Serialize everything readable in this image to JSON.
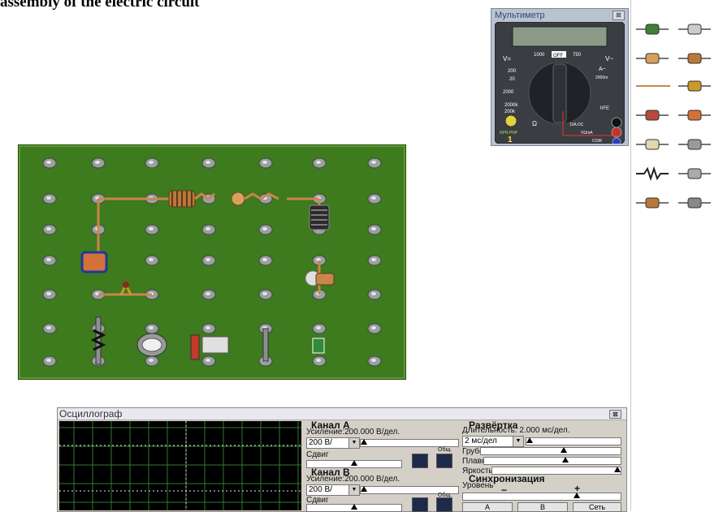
{
  "heading": "assembly of the electric circuit",
  "multimeter": {
    "title": "Мультиметр",
    "close_label": "⊠",
    "label_v_dc": "V=",
    "label_v_ac": "V~",
    "label_off": "OFF",
    "label_1000": "1000",
    "label_750": "750",
    "label_a": "A~",
    "label_20a": "2000m",
    "label_200": "200",
    "label_20": "20",
    "label_2000": "2000",
    "label_hfe": "hFE",
    "label_10a": "10A DC",
    "label_vohm": "VΩmA",
    "label_com": "COM",
    "label_npn": "NPN PNP",
    "label_1": "1",
    "label_200k": "200k",
    "label_2000k": "2000k",
    "label_ohm": "Ω"
  },
  "oscilloscope": {
    "title": "Осциллограф",
    "close_label": "⊠",
    "channel_a": {
      "header": "Канал А",
      "gain": "Усиление:200.000 В/дел.",
      "select": "200 В/",
      "shift": "Сдвиг",
      "common": "Общ."
    },
    "channel_b": {
      "header": "Канал В",
      "gain": "Усиление:200.000 В/дел.",
      "select": "200 В/",
      "shift": "Сдвиг",
      "common": "Общ."
    },
    "sweep": {
      "header": "Развёртка",
      "duration": "Длительность: 2.000 мс/дел.",
      "select": "2 мс/дел",
      "coarse": "Грубо:",
      "fine": "Плавно:",
      "brightness": "Яркость:"
    },
    "sync": {
      "header": "Синхронизация",
      "level": "Уровень",
      "minus": "−",
      "plus": "+",
      "btn_a": "А",
      "btn_b": "В",
      "btn_net": "Сеть"
    }
  },
  "colors": {
    "board": "#3e7a1e",
    "wire": "#c8874a",
    "screen": "#000000",
    "grid": "#2f7a2f"
  }
}
